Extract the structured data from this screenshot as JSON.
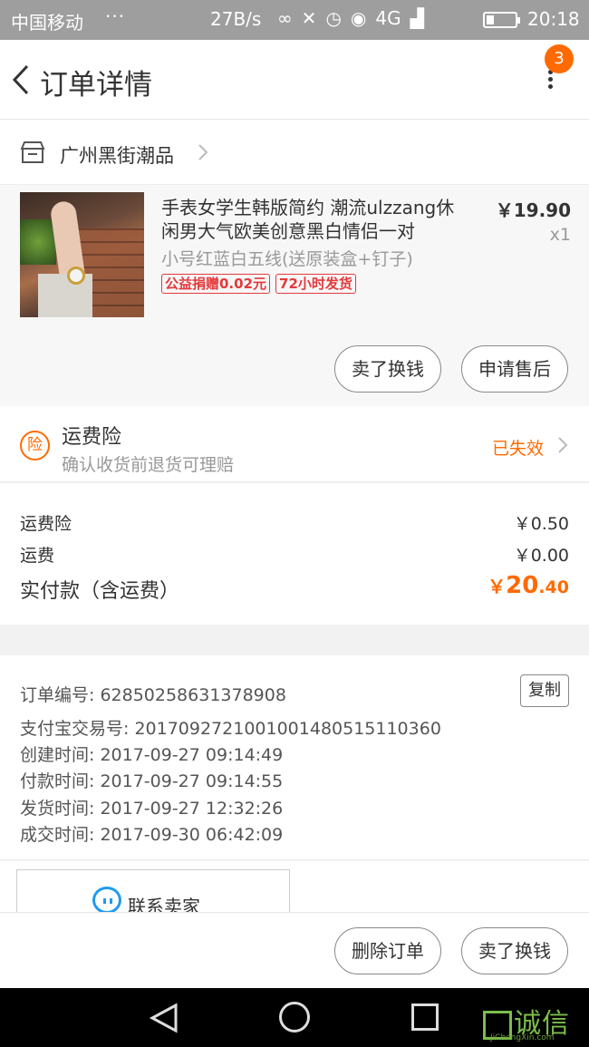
{
  "status_bar": {
    "carrier": "中国移动",
    "dots": "···",
    "speed": "27B/s",
    "network": "4G",
    "time": "20:18"
  },
  "nav": {
    "title": "订单详情",
    "badge_count": "3"
  },
  "shop": {
    "name": "广州黑街潮品"
  },
  "product": {
    "name": "手表女学生韩版简约 潮流ulzzang休闲男大气欧美创意黑白情侣一对",
    "sku": "小号红蓝白五线(送原装盒+钉子)",
    "tags": [
      "公益捐赠0.02元",
      "72小时发货"
    ],
    "price": "￥19.90",
    "quantity": "x1",
    "buttons": [
      "卖了换钱",
      "申请售后"
    ]
  },
  "insurance": {
    "icon_text": "险",
    "title": "运费险",
    "subtitle": "确认收货前退货可理赔",
    "status": "已失效"
  },
  "fees": {
    "shipping_insurance_label": "运费险",
    "shipping_insurance_value": "￥0.50",
    "shipping_label": "运费",
    "shipping_value": "￥0.00",
    "total_label": "实付款（含运费）",
    "total_currency": "￥",
    "total_int": "20",
    "total_dec": ".40"
  },
  "order_info": {
    "order_no": "订单编号: 62850258631378908",
    "copy_label": "复制",
    "alipay_no": "支付宝交易号: 2017092721001001480515110360",
    "created": "创建时间: 2017-09-27 09:14:49",
    "paid": "付款时间: 2017-09-27 09:14:55",
    "shipped": "发货时间: 2017-09-27 12:32:26",
    "completed": "成交时间: 2017-09-30 06:42:09"
  },
  "contact": {
    "label": "联系卖家"
  },
  "bottom_bar": {
    "delete_label": "删除订单",
    "resell_label": "卖了换钱"
  },
  "watermark": {
    "text": "诚信",
    "url": "JiChengXin.com"
  },
  "colors": {
    "accent": "#ff6a00",
    "tag_red": "#e4393c",
    "contact_blue": "#1e9bf0"
  }
}
